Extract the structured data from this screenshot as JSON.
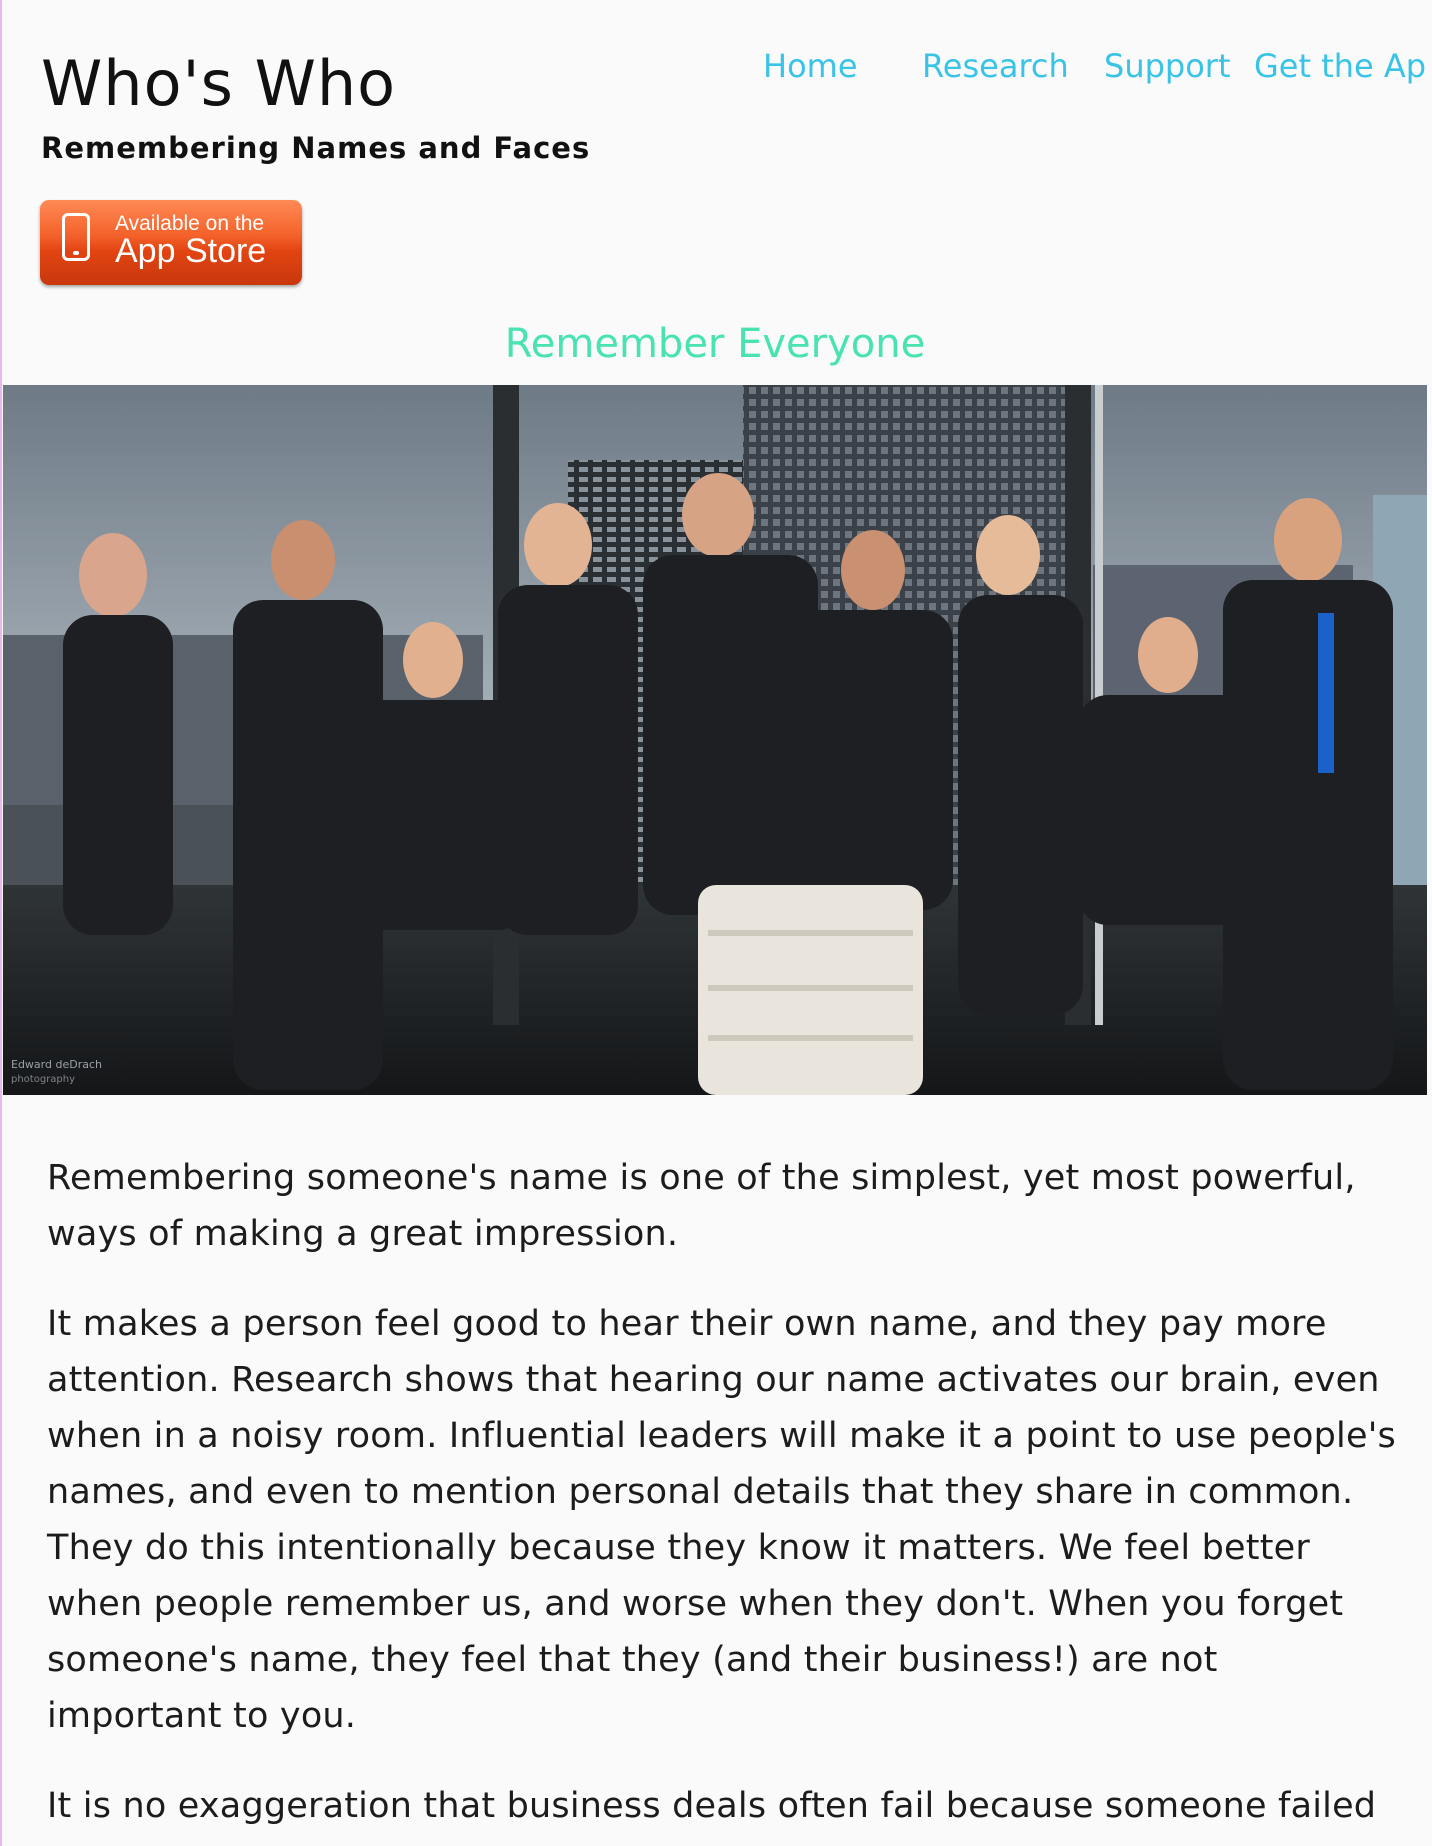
{
  "site": {
    "title": "Who's Who",
    "tagline": "Remembering Names and Faces"
  },
  "nav": {
    "items": [
      {
        "label": "Home"
      },
      {
        "label": "Research"
      },
      {
        "label": "Support"
      },
      {
        "label": "Get the App"
      }
    ]
  },
  "app_store_badge": {
    "line1": "Available on the",
    "line2": "App Store",
    "icon": "phone-icon"
  },
  "main": {
    "heading": "Remember Everyone",
    "hero_image": {
      "description_icon": "team-photo",
      "photo_credit": "Edward deDrach photography"
    },
    "paragraphs": [
      "Remembering someone's name is one of the simplest, yet most powerful, ways of making a great impression.",
      "It makes a person feel good to hear their own name, and they pay more attention. Research shows that hearing our name activates our brain, even when in a noisy room. Influential leaders will make it a point to use people's names, and even to mention personal details that they share in common. They do this intentionally because they know it matters. We feel better when people remember us, and worse when they don't. When you forget someone's name, they feel that they (and their business!) are not important to you.",
      "It is no exaggeration that business deals often fail because someone failed"
    ]
  },
  "colors": {
    "nav_link": "#39c3e6",
    "heading_accent": "#49e3b2",
    "badge_orange": "#f4612a",
    "background": "#fafafa"
  }
}
